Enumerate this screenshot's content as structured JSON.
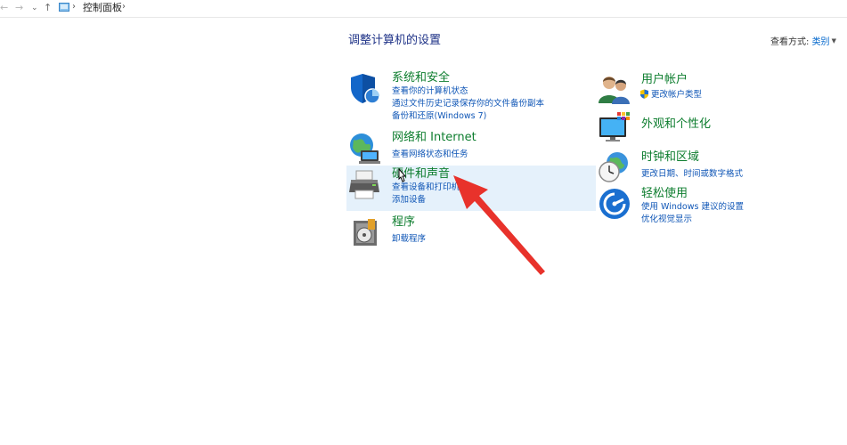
{
  "nav": {
    "back": "←",
    "forward": "→",
    "recent": "⌄",
    "up": "↑",
    "breadcrumb_sep": "›",
    "breadcrumb": "控制面板"
  },
  "page": {
    "title": "调整计算机的设置",
    "view_by_label": "查看方式:",
    "view_by_value": "类别"
  },
  "categories_left": [
    {
      "title": "系统和安全",
      "icon": "system-security-icon",
      "links": [
        "查看你的计算机状态",
        "通过文件历史记录保存你的文件备份副本",
        "备份和还原(Windows 7)"
      ]
    },
    {
      "title": "网络和 Internet",
      "icon": "network-globe-icon",
      "links": [
        "查看网络状态和任务"
      ]
    },
    {
      "title": "硬件和声音",
      "icon": "printer-icon",
      "links": [
        "查看设备和打印机",
        "添加设备"
      ]
    },
    {
      "title": "程序",
      "icon": "programs-icon",
      "links": [
        "卸载程序"
      ]
    }
  ],
  "categories_right": [
    {
      "title": "用户帐户",
      "icon": "users-icon",
      "links": [
        "更改帐户类型"
      ]
    },
    {
      "title": "外观和个性化",
      "icon": "appearance-monitor-icon",
      "links": []
    },
    {
      "title": "时钟和区域",
      "icon": "clock-globe-icon",
      "links": [
        "更改日期、时间或数字格式"
      ]
    },
    {
      "title": "轻松使用",
      "icon": "ease-of-access-icon",
      "links": [
        "使用 Windows 建议的设置",
        "优化视觉显示"
      ]
    }
  ],
  "colors": {
    "title_blue": "#1e3287",
    "category_green": "#0d7d2e",
    "link_blue": "#0f56b6",
    "hover_bg": "#e5f1fb",
    "annotation_red": "#e8322b"
  }
}
